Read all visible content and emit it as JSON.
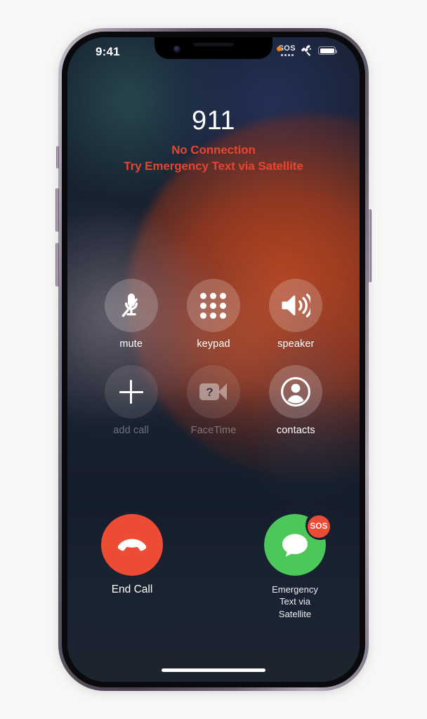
{
  "status_bar": {
    "time": "9:41",
    "privacy_indicator": "microphone-in-use",
    "cellular_status": "SOS",
    "satellite_icon": "satellite-icon",
    "battery_level": "full"
  },
  "call": {
    "callee": "911",
    "status_primary": "No Connection",
    "status_secondary": "Try Emergency Text via Satellite",
    "status_color": "#e8452f"
  },
  "controls": [
    {
      "label": "mute",
      "icon": "microphone-slash-icon",
      "state": "active",
      "enabled": true
    },
    {
      "label": "keypad",
      "icon": "keypad-grid-icon",
      "state": "default",
      "enabled": true
    },
    {
      "label": "speaker",
      "icon": "speaker-waves-icon",
      "state": "default",
      "enabled": true
    },
    {
      "label": "add call",
      "icon": "plus-icon",
      "state": "disabled",
      "enabled": false
    },
    {
      "label": "FaceTime",
      "icon": "facetime-video-unavailable-icon",
      "state": "disabled",
      "enabled": false
    },
    {
      "label": "contacts",
      "icon": "contact-person-icon",
      "state": "default",
      "enabled": true
    }
  ],
  "actions": {
    "end_call": {
      "label": "End Call",
      "icon": "phone-down-icon",
      "color": "#ec4b34"
    },
    "satellite_text": {
      "label_line1": "Emergency",
      "label_line2": "Text via",
      "label_line3": "Satellite",
      "icon": "message-bubble-icon",
      "badge": "SOS",
      "color": "#4cc75a",
      "badge_color": "#ec4b34"
    }
  },
  "system": {
    "home_indicator": "home-indicator"
  }
}
